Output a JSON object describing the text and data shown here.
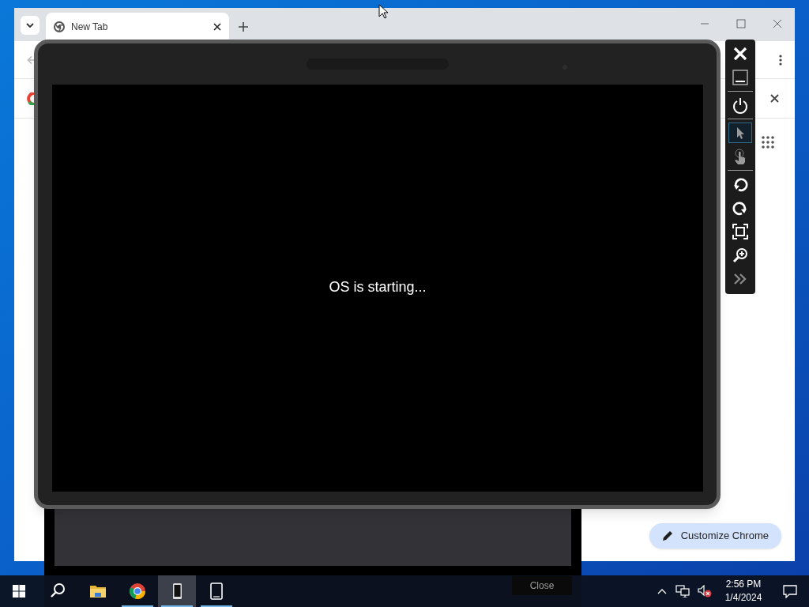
{
  "browser": {
    "tabs": [
      {
        "label": "New Tab",
        "selected": true
      }
    ],
    "customize_button": "Customize Chrome"
  },
  "emulator": {
    "screen_text": "OS is starting...",
    "dialog_button": "Close",
    "toolbar": [
      {
        "kind": "close",
        "selected": false
      },
      {
        "kind": "minimize",
        "selected": false
      },
      {
        "kind": "separator"
      },
      {
        "kind": "power",
        "selected": false
      },
      {
        "kind": "separator"
      },
      {
        "kind": "pointer",
        "selected": true
      },
      {
        "kind": "touch",
        "selected": false
      },
      {
        "kind": "separator"
      },
      {
        "kind": "rotate-left",
        "selected": false
      },
      {
        "kind": "rotate-right",
        "selected": false
      },
      {
        "kind": "fit",
        "selected": false
      },
      {
        "kind": "zoom",
        "selected": false
      },
      {
        "kind": "more",
        "selected": false
      }
    ]
  },
  "taskbar": {
    "apps": [
      {
        "kind": "search",
        "running": false,
        "active": false
      },
      {
        "kind": "explorer",
        "running": false,
        "active": false
      },
      {
        "kind": "chrome",
        "running": true,
        "active": false
      },
      {
        "kind": "emulator",
        "running": true,
        "active": true
      },
      {
        "kind": "device",
        "running": true,
        "active": false
      }
    ],
    "time": "2:56 PM",
    "date": "1/4/2024"
  }
}
